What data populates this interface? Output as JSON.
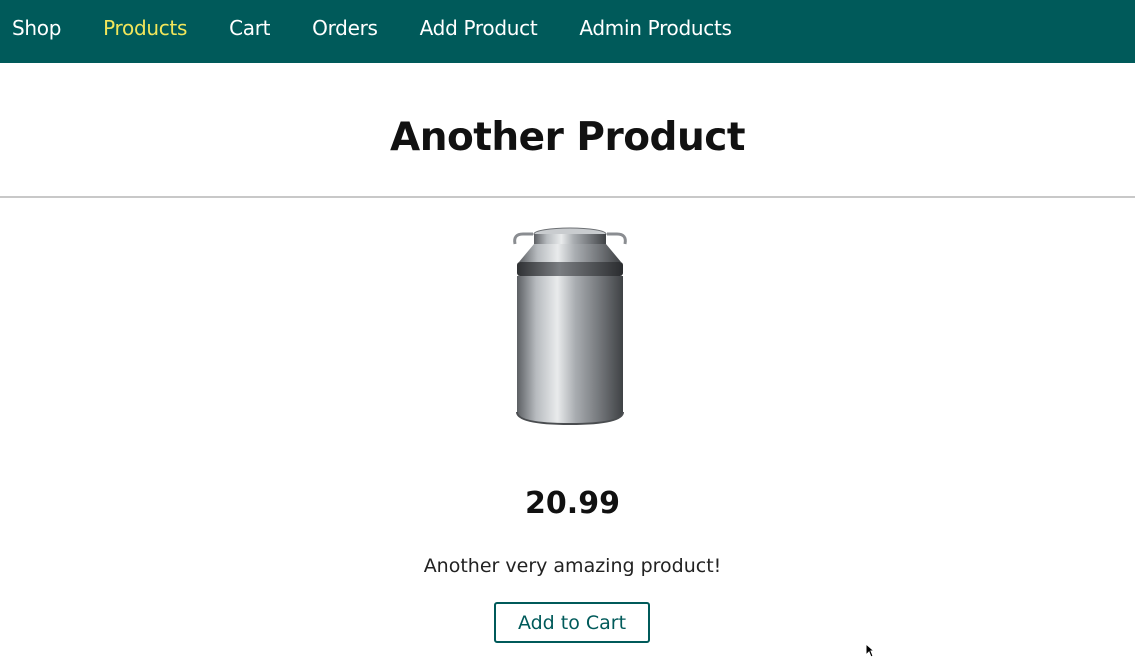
{
  "nav": {
    "items": [
      {
        "label": "Shop"
      },
      {
        "label": "Products"
      },
      {
        "label": "Cart"
      },
      {
        "label": "Orders"
      },
      {
        "label": "Add Product"
      },
      {
        "label": "Admin Products"
      }
    ],
    "active": "Products"
  },
  "product": {
    "title": "Another Product",
    "price": "20.99",
    "description": "Another very amazing product!",
    "image_icon": "milk-can-image",
    "add_to_cart_label": "Add to Cart"
  },
  "colors": {
    "nav_background": "#005a5a",
    "nav_active": "#f2e65a",
    "button_accent": "#005a5a"
  }
}
